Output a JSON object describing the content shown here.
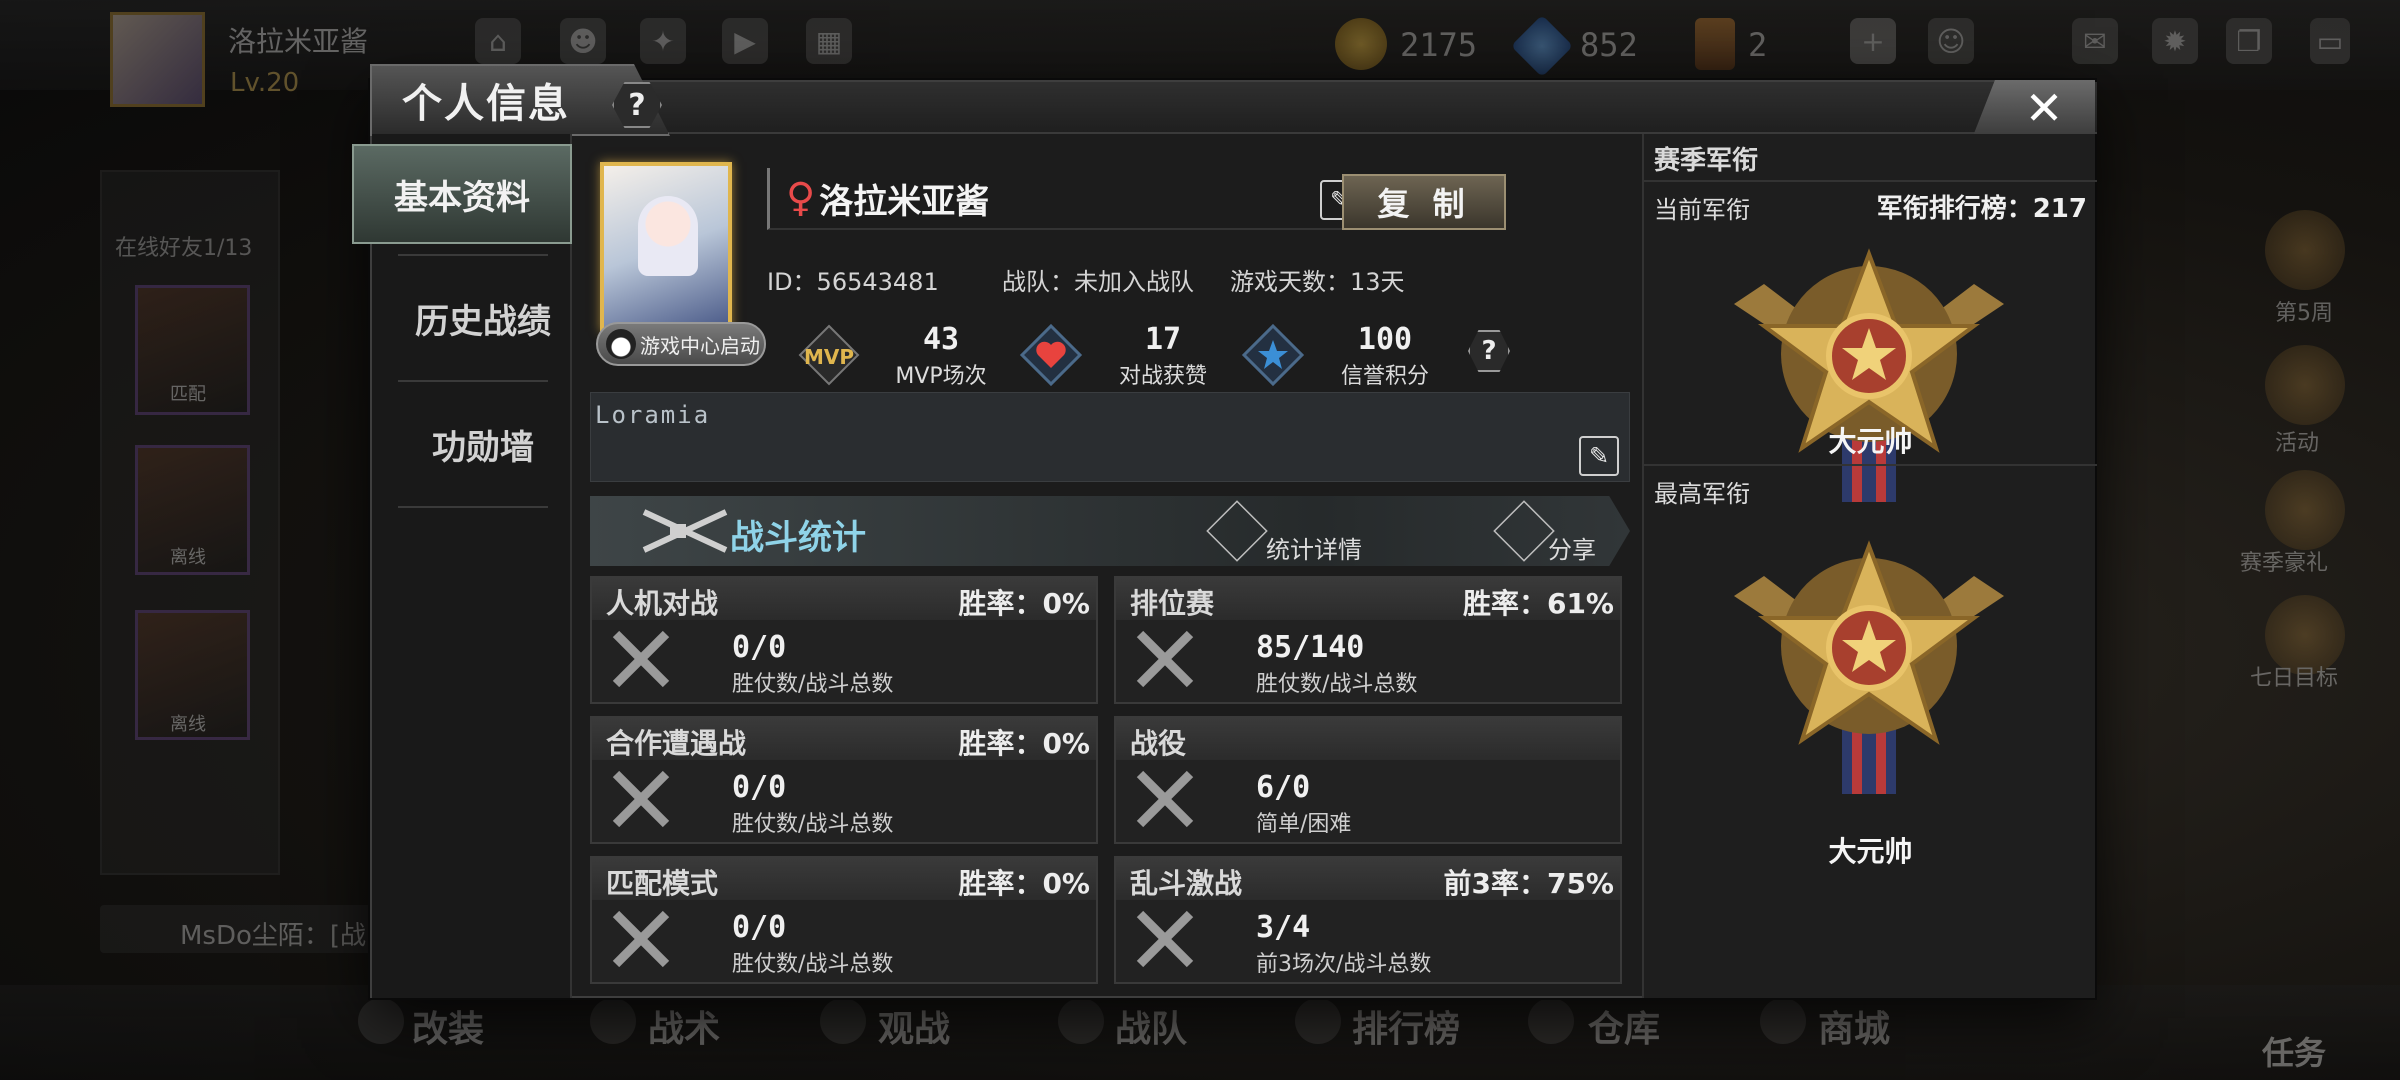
{
  "background": {
    "player_name": "洛拉米亚酱",
    "level": "Lv.20",
    "currencies": [
      "2175",
      "852",
      "2"
    ],
    "friends_online": "在线好友1/13",
    "friend_cards": [
      "匹配",
      "离线",
      "离线"
    ],
    "chat_text": "MsDo尘陌：[战",
    "right_items": [
      "第5周",
      "活动",
      "赛季豪礼",
      "七日目标"
    ],
    "bottom_nav": [
      "改装",
      "战术",
      "观战",
      "战队",
      "排行榜",
      "仓库",
      "商城"
    ],
    "task": "任务"
  },
  "modal": {
    "title": "个人信息",
    "help": "?",
    "close": "✕",
    "nav": [
      "基本资料",
      "历史战绩",
      "功勋墙"
    ],
    "profile": {
      "name": "洛拉米亚酱",
      "gender_icon": "♀",
      "copy_label": "复 制",
      "id_text": "ID：56543481",
      "team_text": "战队：未加入战队",
      "days_text": "游戏天数：13天",
      "game_center": "游戏中心启动",
      "signature": "Loramia"
    },
    "stats": [
      {
        "icon": "mvp-icon",
        "value": "43",
        "label": "MVP场次"
      },
      {
        "icon": "heart-icon",
        "value": "17",
        "label": "对战获赞"
      },
      {
        "icon": "star-icon",
        "value": "100",
        "label": "信誉积分"
      }
    ],
    "battle": {
      "title": "战斗统计",
      "detail": "统计详情",
      "share": "分享"
    },
    "cards": [
      {
        "title": "人机对战",
        "rate": "胜率：0%",
        "value": "0/0",
        "sub": "胜仗数/战斗总数"
      },
      {
        "title": "排位赛",
        "rate": "胜率：61%",
        "value": "85/140",
        "sub": "胜仗数/战斗总数"
      },
      {
        "title": "合作遭遇战",
        "rate": "胜率：0%",
        "value": "0/0",
        "sub": "胜仗数/战斗总数"
      },
      {
        "title": "战役",
        "rate": "",
        "value": "6/0",
        "sub": "简单/困难"
      },
      {
        "title": "匹配模式",
        "rate": "胜率：0%",
        "value": "0/0",
        "sub": "胜仗数/战斗总数"
      },
      {
        "title": "乱斗激战",
        "rate": "前3率：75%",
        "value": "3/4",
        "sub": "前3场次/战斗总数"
      }
    ],
    "rank": {
      "header": "赛季军衔",
      "current_label": "当前军衔",
      "leaderboard": "军衔排行榜：217",
      "current_rank": "大元帅",
      "highest_label": "最高军衔",
      "highest_rank": "大元帅"
    },
    "colors": {
      "accent_cyan": "#8fd3e8",
      "gold": "#e0b64e",
      "heart_red": "#e8433e",
      "star_blue": "#3b8fd6"
    }
  }
}
